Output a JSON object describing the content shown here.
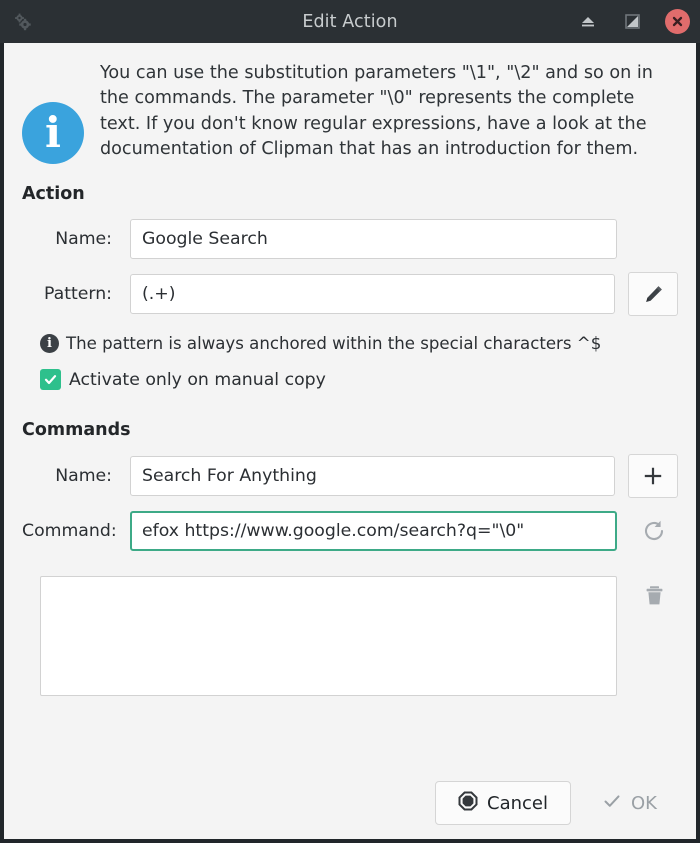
{
  "window": {
    "title": "Edit Action",
    "app_icon": "gears-icon",
    "titlebar_buttons": [
      {
        "name": "shade-button",
        "icon": "shade-icon"
      },
      {
        "name": "maximize-button",
        "icon": "maximize-icon"
      },
      {
        "name": "close-button",
        "icon": "close-icon"
      }
    ]
  },
  "info": {
    "icon": "info-icon",
    "glyph": "i",
    "text": "You can use the substitution parameters \"\\1\", \"\\2\" and so on in the commands. The parameter \"\\0\" represents the complete text. If you don't know regular expressions, have a look at the documentation of Clipman that has an introduction for them."
  },
  "action": {
    "heading": "Action",
    "name_label": "Name:",
    "name_value": "Google Search",
    "name_placeholder": "",
    "pattern_label": "Pattern:",
    "pattern_value": "(.+)",
    "pattern_placeholder": "",
    "edit_button_icon": "pencil-icon",
    "hint_glyph": "i",
    "hint_text": "The pattern is always anchored within the special characters ^$",
    "checkbox_label": "Activate only on manual copy",
    "checkbox_checked": true,
    "checkbox_glyph": "✔"
  },
  "commands": {
    "heading": "Commands",
    "name_label": "Name:",
    "name_value": "Search For Anything",
    "name_placeholder": "",
    "add_button_icon": "plus-icon",
    "add_button_glyph": "+",
    "command_label": "Command:",
    "command_value": "efox https://www.google.com/search?q=\"\\0\"",
    "command_placeholder": "",
    "update_button_icon": "refresh-icon",
    "delete_button_icon": "trash-icon",
    "list_items": []
  },
  "footer": {
    "cancel_label": "Cancel",
    "cancel_icon": "cancel-octagon-icon",
    "ok_label": "OK",
    "ok_icon": "check-icon",
    "ok_enabled": false
  },
  "colors": {
    "titlebar_bg": "#2b3034",
    "window_bg": "#f4f4f4",
    "info_blue": "#3aa3dd",
    "checkbox_green": "#2ec08c",
    "focus_green": "#3daa87",
    "close_red": "#e06c6c"
  }
}
